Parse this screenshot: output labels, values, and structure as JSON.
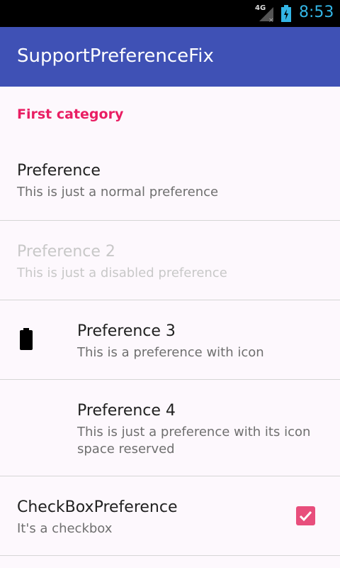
{
  "status_bar": {
    "network": "4G",
    "time": "8:53"
  },
  "app_bar": {
    "title": "SupportPreferenceFix"
  },
  "category": {
    "title": "First category"
  },
  "preferences": [
    {
      "title": "Preference",
      "summary": "This is just a normal preference",
      "enabled": true
    },
    {
      "title": "Preference 2",
      "summary": "This is just a disabled preference",
      "enabled": false
    },
    {
      "title": "Preference 3",
      "summary": "This is a preference with icon",
      "icon": "battery-icon",
      "enabled": true
    },
    {
      "title": "Preference 4",
      "summary": "This is just a preference with its icon space reserved",
      "enabled": true
    },
    {
      "title": "CheckBoxPreference",
      "summary": "It's a checkbox",
      "checked": true,
      "enabled": true
    }
  ],
  "colors": {
    "primary": "#3f51b5",
    "accent": "#e91e63",
    "status_bar": "#000000"
  }
}
